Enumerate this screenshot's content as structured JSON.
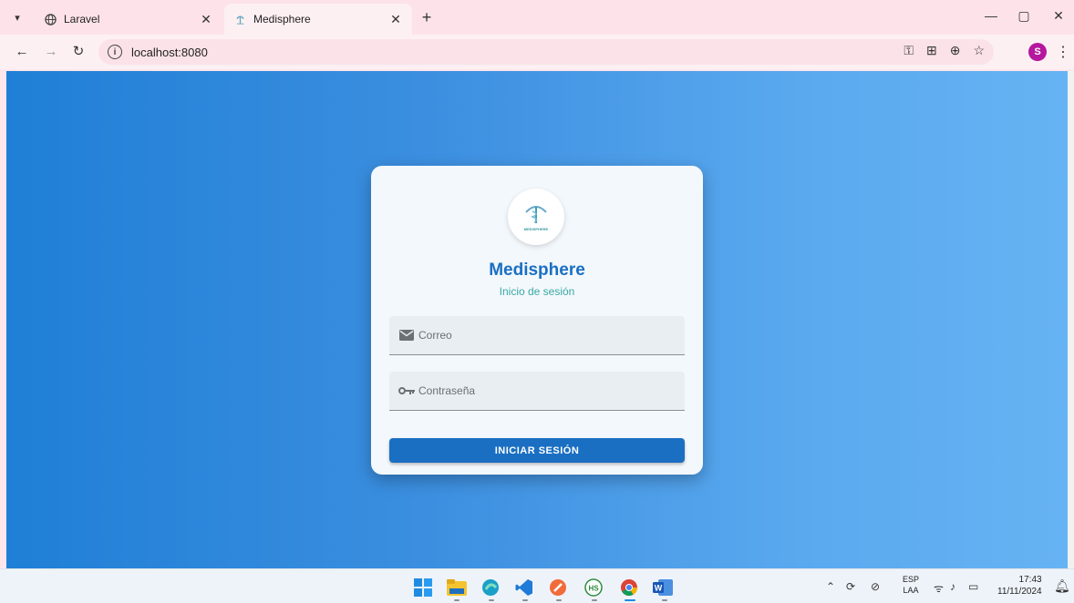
{
  "browser": {
    "tabs": [
      {
        "title": "Laravel",
        "active": false
      },
      {
        "title": "Medisphere",
        "active": true
      }
    ],
    "url": "localhost:8080",
    "profile_initial": "S"
  },
  "login": {
    "logo_text": "MEDISPHERE",
    "title": "Medisphere",
    "subtitle": "Inicio de sesión",
    "email_placeholder": "Correo",
    "password_placeholder": "Contraseña",
    "submit_label": "INICIAR SESIÓN"
  },
  "taskbar": {
    "language": "ESP",
    "layout": "LAA",
    "time": "17:43",
    "date": "11/11/2024"
  },
  "colors": {
    "primary": "#1a6fc2",
    "accent": "#3aa8a5",
    "gradient_start": "#1f7fd6",
    "gradient_end": "#66b3f3"
  }
}
